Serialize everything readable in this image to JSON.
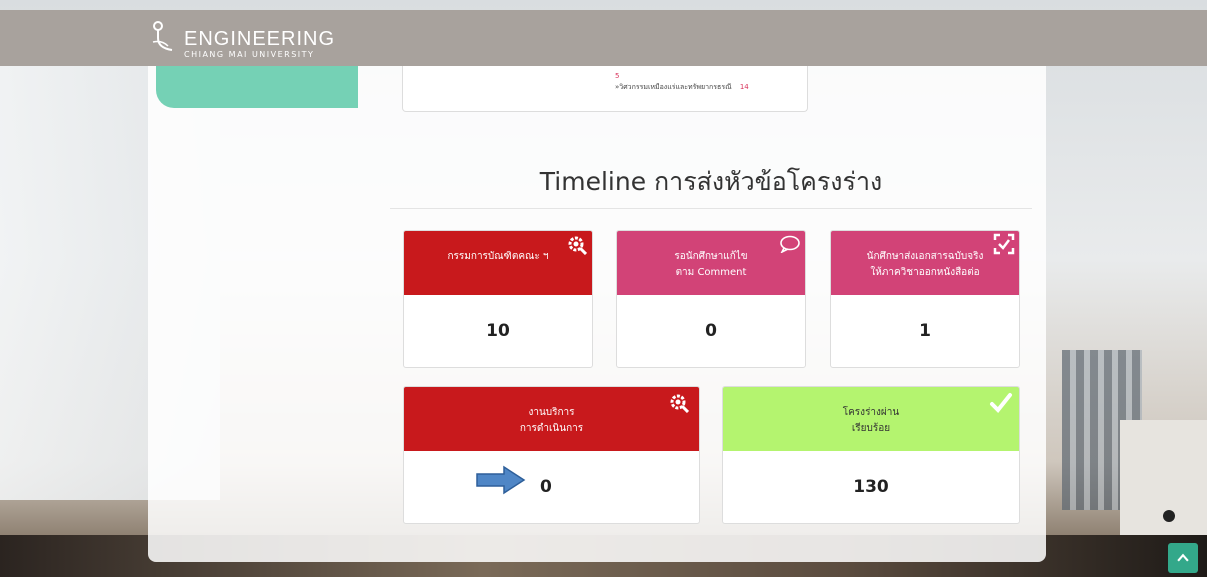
{
  "brand": {
    "title": "ENGINEERING",
    "subtitle": "CHIANG MAI UNIVERSITY"
  },
  "top_panel": {
    "number": "5",
    "link_label": "»วิศวกรรมเหมืองแร่และทรัพยากรธรณี",
    "link_count": "14"
  },
  "timeline": {
    "title": "Timeline การส่งหัวข้อโครงร่าง"
  },
  "cards": [
    {
      "label1": "กรรมการบัณฑิตคณะ ฯ",
      "label2": "",
      "value": "10",
      "color": "#c8191c",
      "icon": "gear-search-icon"
    },
    {
      "label1": "รอนักศึกษาแก้ไข",
      "label2": "ตาม Comment",
      "value": "0",
      "color": "#d24377",
      "icon": "speech-bubble-icon"
    },
    {
      "label1": "นักศึกษาส่งเอกสารฉบับจริง",
      "label2": "ให้ภาควิชาออกหนังสือต่อ",
      "value": "1",
      "color": "#d24377",
      "icon": "expand-check-icon"
    },
    {
      "label1": "งานบริการ",
      "label2": "การดำเนินการ",
      "value": "0",
      "color": "#c8191c",
      "icon": "gear-search-icon"
    },
    {
      "label1": "โครงร่างผ่าน",
      "label2": "เรียบร้อย",
      "value": "130",
      "color": "#b4f46f",
      "icon": "checkmark-icon"
    }
  ],
  "colors": {
    "navbar": "#a8a29d",
    "mint": "#75d1b5",
    "arrow": "#4f86c6",
    "back_to_top": "#33a88a"
  }
}
